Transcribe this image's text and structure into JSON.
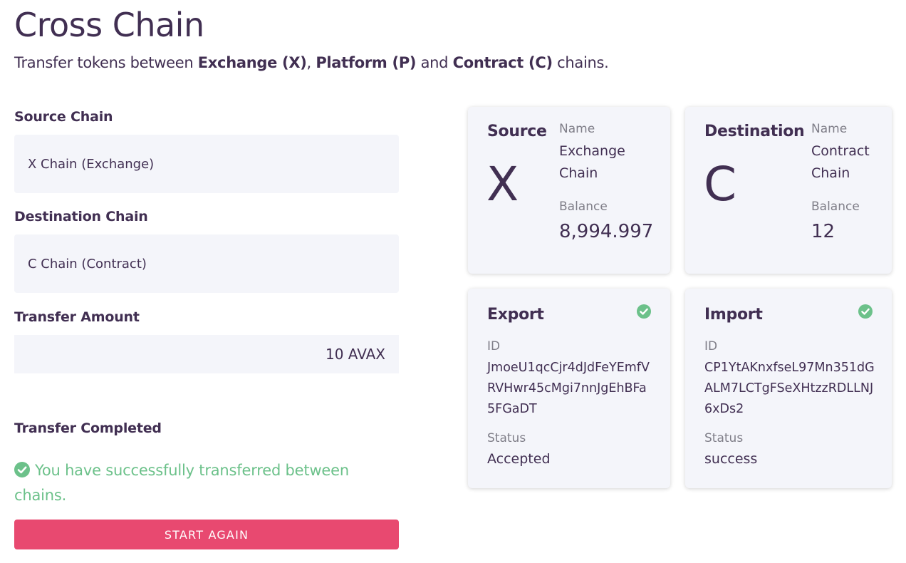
{
  "header": {
    "title": "Cross Chain",
    "subtitle_prefix": "Transfer tokens between ",
    "chain_x": "Exchange (X)",
    "sep1": ", ",
    "chain_p": "Platform (P)",
    "sep2": " and ",
    "chain_c": "Contract (C)",
    "subtitle_suffix": " chains."
  },
  "form": {
    "source_label": "Source Chain",
    "source_value": "X Chain (Exchange)",
    "destination_label": "Destination Chain",
    "destination_value": "C Chain (Contract)",
    "amount_label": "Transfer Amount",
    "amount_value": "10 AVAX",
    "completed_title": "Transfer Completed",
    "success_message": "You have successfully transferred between chains.",
    "start_again_label": "START AGAIN"
  },
  "source_card": {
    "title": "Source",
    "letter": "X",
    "name_label": "Name",
    "name_value": "Exchange Chain",
    "balance_label": "Balance",
    "balance_value": "8,994.997"
  },
  "destination_card": {
    "title": "Destination",
    "letter": "C",
    "name_label": "Name",
    "name_value": "Contract Chain",
    "balance_label": "Balance",
    "balance_value": "12"
  },
  "export_card": {
    "title": "Export",
    "id_label": "ID",
    "id_value": "JmoeU1qcCjr4dJdFeYEmfVRVHwr45cMgi7nnJgEhBFa5FGaDT",
    "status_label": "Status",
    "status_value": "Accepted"
  },
  "import_card": {
    "title": "Import",
    "id_label": "ID",
    "id_value": "CP1YtAKnxfseL97Mn351dGALM7LCTgFSeXHtzzRDLLNJ6xDs2",
    "status_label": "Status",
    "status_value": "success"
  },
  "colors": {
    "text": "#412f52",
    "muted": "#7f7e88",
    "card_bg": "#f4f5fa",
    "success": "#6cc18a",
    "accent": "#e84970"
  },
  "icons": {
    "success": "check-circle-icon"
  }
}
